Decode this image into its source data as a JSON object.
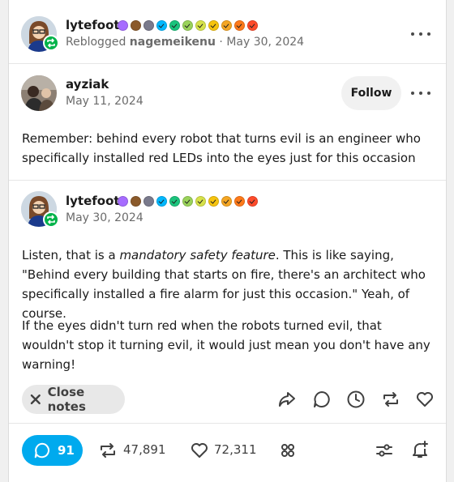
{
  "post_header": {
    "username": "lytefoot",
    "reblogged_prefix": "Reblogged",
    "reblogged_from": "nagemeikenu",
    "separator": "·",
    "date": "May 30, 2024"
  },
  "badge_colors": [
    "#a66cff",
    "#8b5a2b",
    "#7a7a8c",
    "#00b8ff",
    "#1bc47d",
    "#9ad35a",
    "#d7e24a",
    "#f6c40f",
    "#f5a623",
    "#ff7a1a",
    "#ff4b2b"
  ],
  "original": {
    "username": "ayziak",
    "date": "May 11, 2024",
    "follow_label": "Follow",
    "body": "Remember: behind every robot that turns evil is an engineer who specifically installed red LEDs into the eyes just for this occasion"
  },
  "reply": {
    "username": "lytefoot",
    "date": "May 30, 2024",
    "para1_a": "Listen, that is a ",
    "para1_em": "mandatory safety feature",
    "para1_b": ". This is like saying, \"Behind every building that starts on fire, there's an architect who specifically installed a fire alarm for just this occasion.\" Yeah, of course.",
    "para2": "If the eyes didn't turn red when the robots turned evil, that wouldn't stop it turning evil, it would just mean you don't have any warning!"
  },
  "actions": {
    "close_notes_label": "Close notes"
  },
  "footer": {
    "notes_count": "91",
    "reblogs_count": "47,891",
    "likes_count": "72,311"
  }
}
